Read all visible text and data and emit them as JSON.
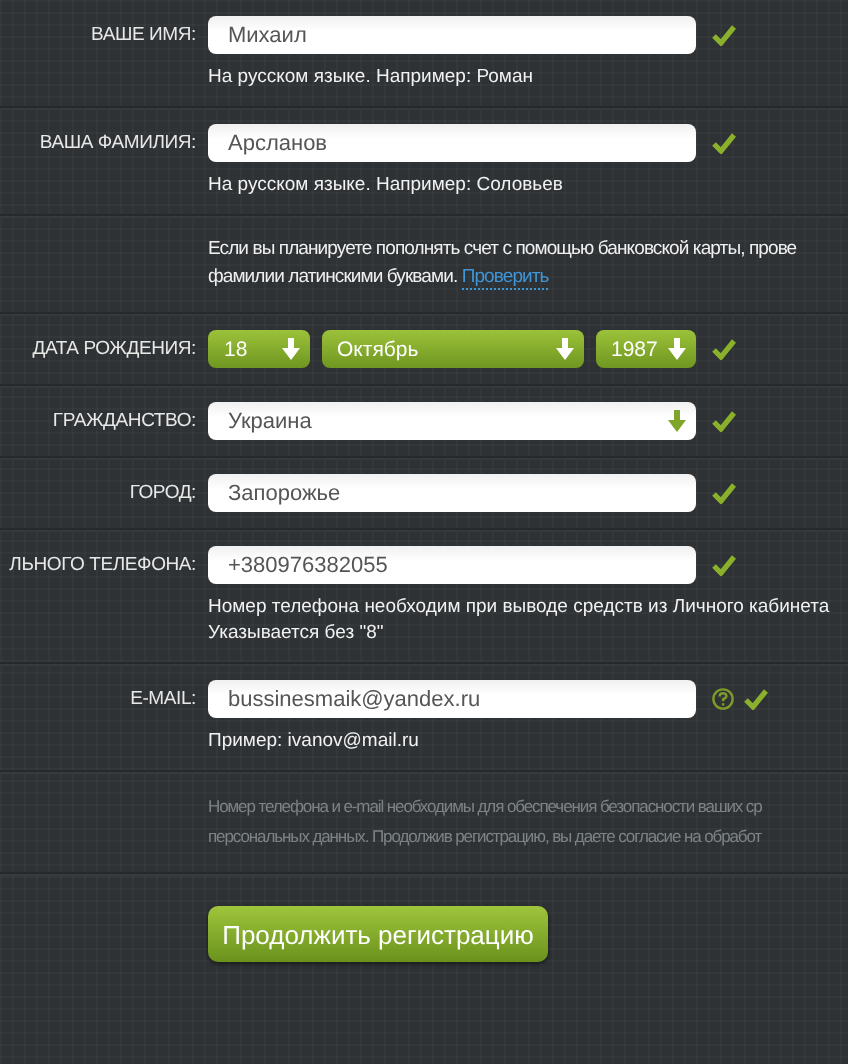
{
  "rows": [
    {
      "kind": "text",
      "label": "ВАШЕ ИМЯ:",
      "value": "Михаил",
      "valid": true,
      "help": false,
      "hints": [
        "На русском языке. Например: Роман"
      ]
    },
    {
      "kind": "text",
      "label": "ВАША ФАМИЛИЯ:",
      "value": "Арсланов",
      "valid": true,
      "help": false,
      "hints": [
        "На русском языке. Например: Соловьев"
      ]
    },
    {
      "kind": "note",
      "lines": [
        "Если вы планируете пополнять счет с помощью банковской карты, прове",
        "фамилии латинскими буквами."
      ],
      "link": "Проверить"
    },
    {
      "kind": "date",
      "label": "ДАТА РОЖДЕНИЯ:",
      "parts": [
        "18",
        "Октябрь",
        "1987"
      ],
      "valid": true
    },
    {
      "kind": "select",
      "label": "ГРАЖДАНСТВО:",
      "value": "Украина",
      "valid": true
    },
    {
      "kind": "text",
      "label": "ГОРОД:",
      "value": "Запорожье",
      "valid": true,
      "help": false,
      "hints": []
    },
    {
      "kind": "text",
      "label": "ЛЬНОГО ТЕЛЕФОНА:",
      "value": "+380976382055",
      "valid": true,
      "help": false,
      "hints": [
        "Номер телефона необходим при выводе средств из Личного кабинета",
        "Указывается без \"8\""
      ]
    },
    {
      "kind": "text",
      "label": "E-MAIL:",
      "value": "bussinesmaik@yandex.ru",
      "valid": true,
      "help": true,
      "hints": [
        "Пример: ivanov@mail.ru"
      ]
    },
    {
      "kind": "disclaimer",
      "lines": [
        "Номер телефона и e-mail необходимы для обеспечения безопасности ваших ср",
        "персональных данных. Продолжив регистрацию, вы даете согласие на обработ"
      ]
    }
  ],
  "submit": {
    "label": "Продолжить регистрацию"
  }
}
